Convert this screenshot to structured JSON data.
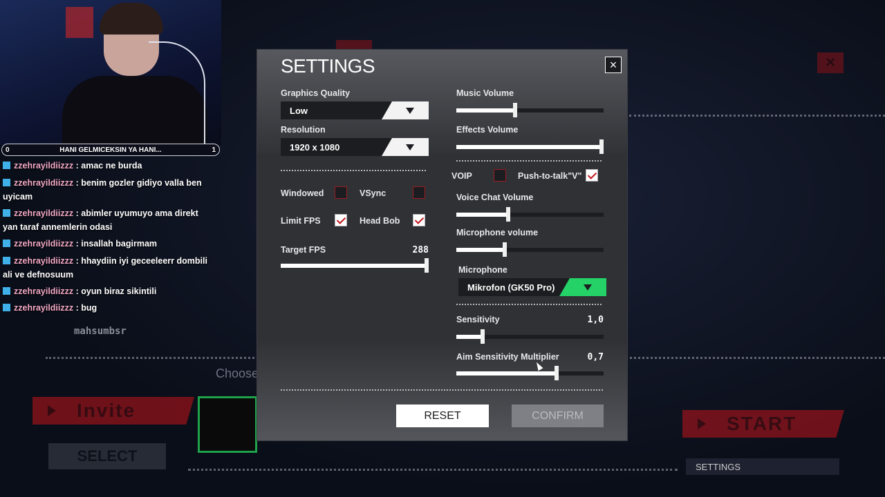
{
  "background": {
    "invite_label": "Invite",
    "select_label": "SELECT",
    "start_label": "START",
    "settings_bar_label": "SETTINGS",
    "choose_label": "Choose"
  },
  "chat": {
    "banner_left": "0",
    "banner_text": "HANI GELMICEKSIN YA HANI...",
    "banner_right": "1",
    "messages": [
      {
        "user": "zzehrayildiizzz",
        "text": " : amac ne burda"
      },
      {
        "user": "zzehrayildiizzz",
        "text": " : benim gozler gidiyo valla ben uyicam"
      },
      {
        "user": "zzehrayildiizzz",
        "text": " : abimler uyumuyo ama direkt yan taraf annemlerin odasi"
      },
      {
        "user": "zzehrayildiizzz",
        "text": " : insallah bagirmam"
      },
      {
        "user": "zzehrayildiizzz",
        "text": " : hhaydiin iyi geceeleerr dombili ali ve defnosuum"
      },
      {
        "user": "zzehrayildiizzz",
        "text": " : oyun biraz sikintili"
      },
      {
        "user": "zzehrayildiizzz",
        "text": " : bug"
      }
    ],
    "ghost_name": "mahsumbsr"
  },
  "settings": {
    "title": "SETTINGS",
    "close_icon": "×",
    "graphics_quality_label": "Graphics Quality",
    "graphics_quality_value": "Low",
    "resolution_label": "Resolution",
    "resolution_value": "1920 x 1080",
    "windowed_label": "Windowed",
    "windowed_checked": false,
    "vsync_label": "VSync",
    "vsync_checked": false,
    "limit_fps_label": "Limit FPS",
    "limit_fps_checked": true,
    "head_bob_label": "Head Bob",
    "head_bob_checked": true,
    "target_fps_label": "Target FPS",
    "target_fps_value": "288",
    "target_fps_level": 1.0,
    "music_volume_label": "Music Volume",
    "music_volume_level": 0.4,
    "effects_volume_label": "Effects Volume",
    "effects_volume_level": 1.0,
    "voip_label": "VOIP",
    "voip_checked": false,
    "push_to_talk_label": "Push-to-talk\"V\"",
    "push_to_talk_checked": true,
    "voice_chat_volume_label": "Voice Chat Volume",
    "voice_chat_volume_level": 0.35,
    "microphone_volume_label": "Microphone volume",
    "microphone_volume_level": 0.33,
    "microphone_label": "Microphone",
    "microphone_value": "Mikrofon (GK50 Pro)",
    "sensitivity_label": "Sensitivity",
    "sensitivity_value": "1,0",
    "sensitivity_level": 0.18,
    "aim_sensitivity_label": "Aim Sensitivity Multiplier",
    "aim_sensitivity_value": "0,7",
    "aim_sensitivity_level": 0.68,
    "reset_label": "RESET",
    "confirm_label": "CONFIRM"
  },
  "colors": {
    "panel_bg": "#2f3135",
    "accent_red": "#c3151c",
    "accent_green": "#25d268"
  }
}
